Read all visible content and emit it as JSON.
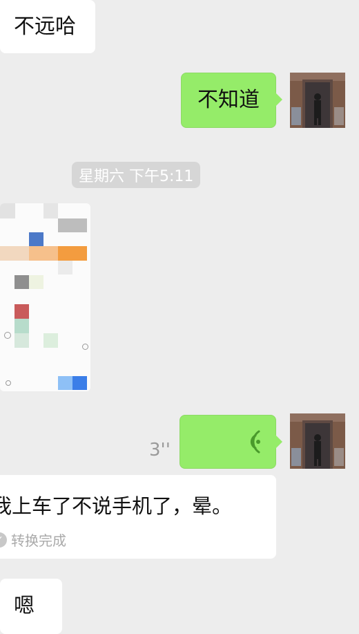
{
  "messages": {
    "m1": {
      "text": "不远哈"
    },
    "m2": {
      "text": "不知道"
    },
    "timestamp": {
      "text": "星期六 下午5:11"
    },
    "voice": {
      "duration": "3''"
    },
    "transcription": {
      "text": "我上车了不说手机了，晕。",
      "status": "转换完成"
    },
    "m5": {
      "text": "嗯"
    }
  },
  "icons": {
    "voice_wave": "voice-wave-icon",
    "check": "check-circle-icon"
  },
  "colors": {
    "background": "#ededed",
    "outgoing_bubble": "#95ec69",
    "incoming_bubble": "#ffffff",
    "timestamp_pill": "#d6d6d6"
  }
}
